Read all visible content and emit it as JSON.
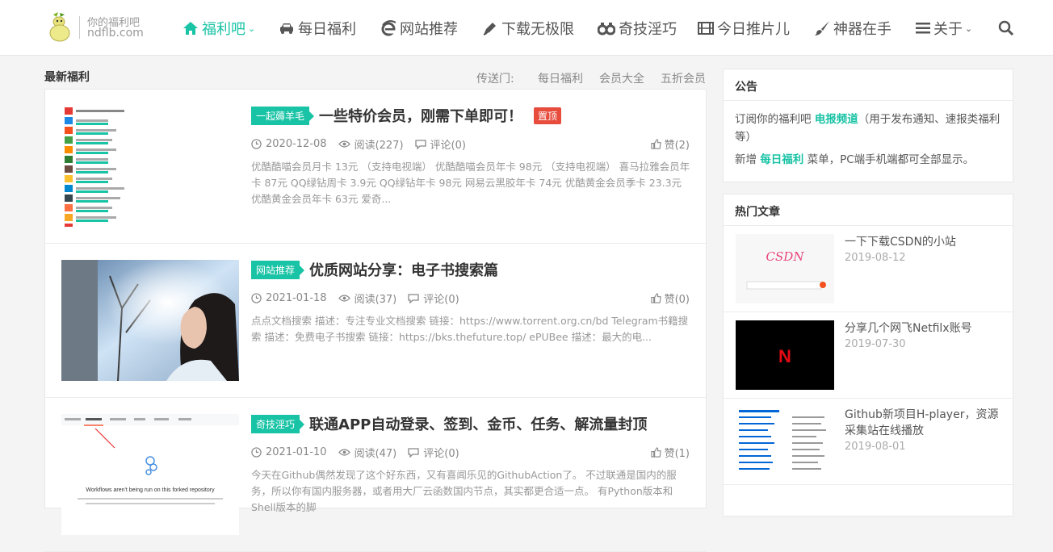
{
  "brand": {
    "subtitle": "你的福利吧",
    "domain": "ndflb.com"
  },
  "nav": {
    "items": [
      {
        "label": "福利吧",
        "icon": "home-icon",
        "active": true,
        "dropdown": true
      },
      {
        "label": "每日福利",
        "icon": "car-icon"
      },
      {
        "label": "网站推荐",
        "icon": "ie-icon"
      },
      {
        "label": "下载无极限",
        "icon": "pen-icon"
      },
      {
        "label": "奇技淫巧",
        "icon": "binoculars-icon"
      },
      {
        "label": "今日推片儿",
        "icon": "film-icon"
      },
      {
        "label": "神器在手",
        "icon": "brush-icon"
      },
      {
        "label": "关于",
        "icon": "list-icon",
        "dropdown": true
      }
    ],
    "search_icon": "search-icon"
  },
  "main": {
    "section_title": "最新福利",
    "teleport_label": "传送门:",
    "teleport_links": [
      "每日福利",
      "会员大全",
      "五折会员"
    ]
  },
  "posts": [
    {
      "category": "一起薅羊毛",
      "title": "一些特价会员，刚需下单即可！",
      "badge": "置顶",
      "date": "2020-12-08",
      "views": "阅读(227)",
      "comments": "评论(0)",
      "likes": "赞(2)",
      "excerpt": "优酷酷喵会员月卡 13元 （支持电视端） 优酷酷喵会员年卡 98元 （支持电视端） 喜马拉雅会员年卡 87元 QQ绿钻周卡 3.9元 QQ绿钻年卡 98元 网易云黑胶年卡 74元 优酷黄金会员季卡 23.3元 优酷黄金会员年卡 63元 爱奇..."
    },
    {
      "category": "网站推荐",
      "title": "优质网站分享：电子书搜索篇",
      "date": "2021-01-18",
      "views": "阅读(37)",
      "comments": "评论(0)",
      "likes": "赞(0)",
      "excerpt": "点点文档搜索 描述：专注专业文档搜索 链接：https://www.torrent.org.cn/bd Telegram书籍搜索 描述：免费电子书搜索 链接：https://bks.thefuture.top/ ePUBee 描述：最大的电..."
    },
    {
      "category": "奇技淫巧",
      "title": "联通APP自动登录、签到、金币、任务、解流量封顶",
      "date": "2021-01-10",
      "views": "阅读(47)",
      "comments": "评论(0)",
      "likes": "赞(1)",
      "excerpt": "今天在Github偶然发现了这个好东西，又有喜闻乐见的GithubAction了。 不过联通是国内的服务，所以你有国内服务器，或者用大厂云函数国内节点，其实都更合适一点。 有Python版本和Shell版本的脚",
      "thumb_text": "Workflows aren't being run on this forked repository"
    }
  ],
  "sidebar": {
    "notice": {
      "title": "公告",
      "line1_pre": "订阅你的福利吧 ",
      "line1_link": "电报频道",
      "line1_post": "（用于发布通知、速报类福利等）",
      "line2_pre": "新增 ",
      "line2_link": "每日福利",
      "line2_post": " 菜单，PC端手机端都可全部显示。"
    },
    "hot": {
      "title": "热门文章",
      "items": [
        {
          "title": "一下下载CSDN的小站",
          "date": "2019-08-12",
          "thumb_text": "CSDN"
        },
        {
          "title": "分享几个网飞Netfilx账号",
          "date": "2019-07-30",
          "thumb_text": "N"
        },
        {
          "title": "Github新项目H-player，资源采集站在线播放",
          "date": "2019-08-01"
        }
      ]
    }
  },
  "colors": {
    "accent": "#19c3a5",
    "badge": "#e74c3c"
  }
}
